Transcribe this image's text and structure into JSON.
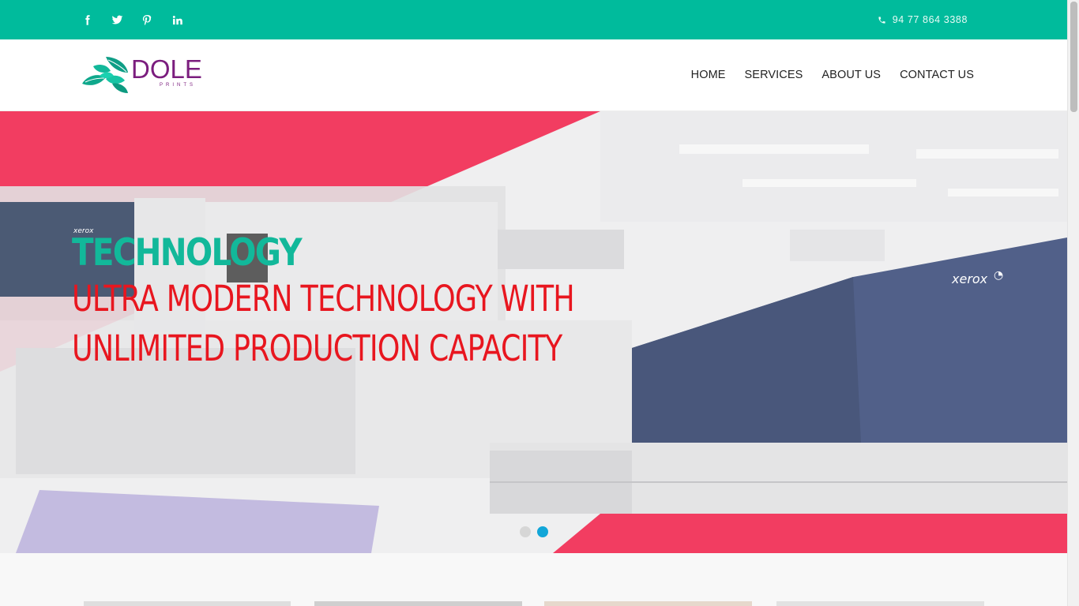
{
  "topbar": {
    "social": [
      {
        "name": "facebook-icon"
      },
      {
        "name": "twitter-icon"
      },
      {
        "name": "pinterest-icon"
      },
      {
        "name": "linkedin-icon"
      }
    ],
    "phone": "94 77 864 3388",
    "bg_color": "#00bb9c"
  },
  "header": {
    "logo_text": "DOLE",
    "logo_subtext": "PRINTS",
    "nav": [
      {
        "label": "HOME"
      },
      {
        "label": "SERVICES"
      },
      {
        "label": "ABOUT US"
      },
      {
        "label": "CONTACT US"
      }
    ]
  },
  "hero": {
    "title": "TECHNOLOGY",
    "subtitle_line1": "ULTRA MODERN TECHNOLOGY WITH",
    "subtitle_line2": "UNLIMITED PRODUCTION CAPACITY",
    "title_color": "#12b89a",
    "subtitle_color": "#e8161f",
    "accent_color": "#f0133f",
    "slides_total": 2,
    "active_slide": 2
  }
}
